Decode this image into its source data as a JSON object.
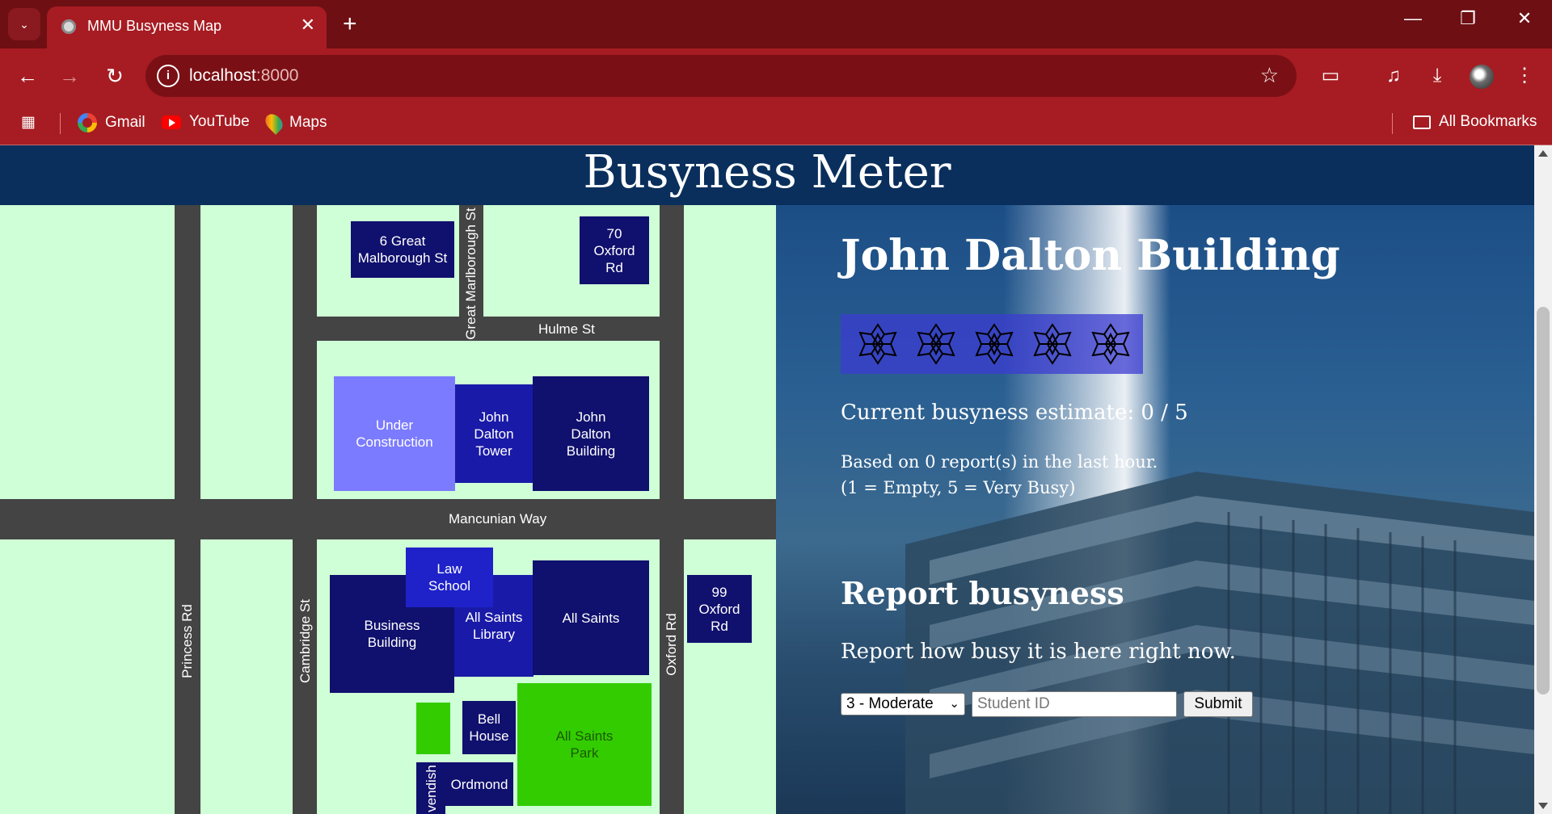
{
  "browser": {
    "tab_title": "MMU Busyness Map",
    "url_host": "localhost",
    "url_port": ":8000",
    "bookmarks": [
      "Gmail",
      "YouTube",
      "Maps"
    ],
    "all_bookmarks": "All Bookmarks"
  },
  "page": {
    "title": "Busyness Meter"
  },
  "map": {
    "roads": {
      "hulme_st": "Hulme St",
      "great_marlborough_st": "Great Marlborough St",
      "mancunian_way": "Mancunian Way",
      "princess_rd": "Princess Rd",
      "cambridge_st": "Cambridge St",
      "oxford_rd": "Oxford Rd",
      "cavendish_partial": "vendish"
    },
    "buildings": {
      "six_great_marlborough": "6 Great Malborough St",
      "seventy_oxford_rd": "70 Oxford Rd",
      "under_construction": "Under Construction",
      "john_dalton_tower": "John Dalton Tower",
      "john_dalton_building": "John Dalton Building",
      "law_school": "Law School",
      "business_building": "Business Building",
      "all_saints_library": "All Saints Library",
      "all_saints": "All Saints",
      "ninety_nine_oxford_rd": "99 Oxford Rd",
      "bell_house": "Bell House",
      "all_saints_park": "All Saints Park",
      "ordmond": "Ordmond"
    }
  },
  "info": {
    "building_name": "John Dalton Building",
    "rating_max": 5,
    "rating_value": 0,
    "estimate_text": "Current busyness estimate: 0 / 5",
    "report_count_text": "Based on 0 report(s) in the last hour.",
    "scale_note": "(1 = Empty, 5 = Very Busy)",
    "report_heading": "Report busyness",
    "report_prompt": "Report how busy it is here right now.",
    "select_value": "3 - Moderate",
    "student_id_placeholder": "Student ID",
    "submit_label": "Submit"
  }
}
